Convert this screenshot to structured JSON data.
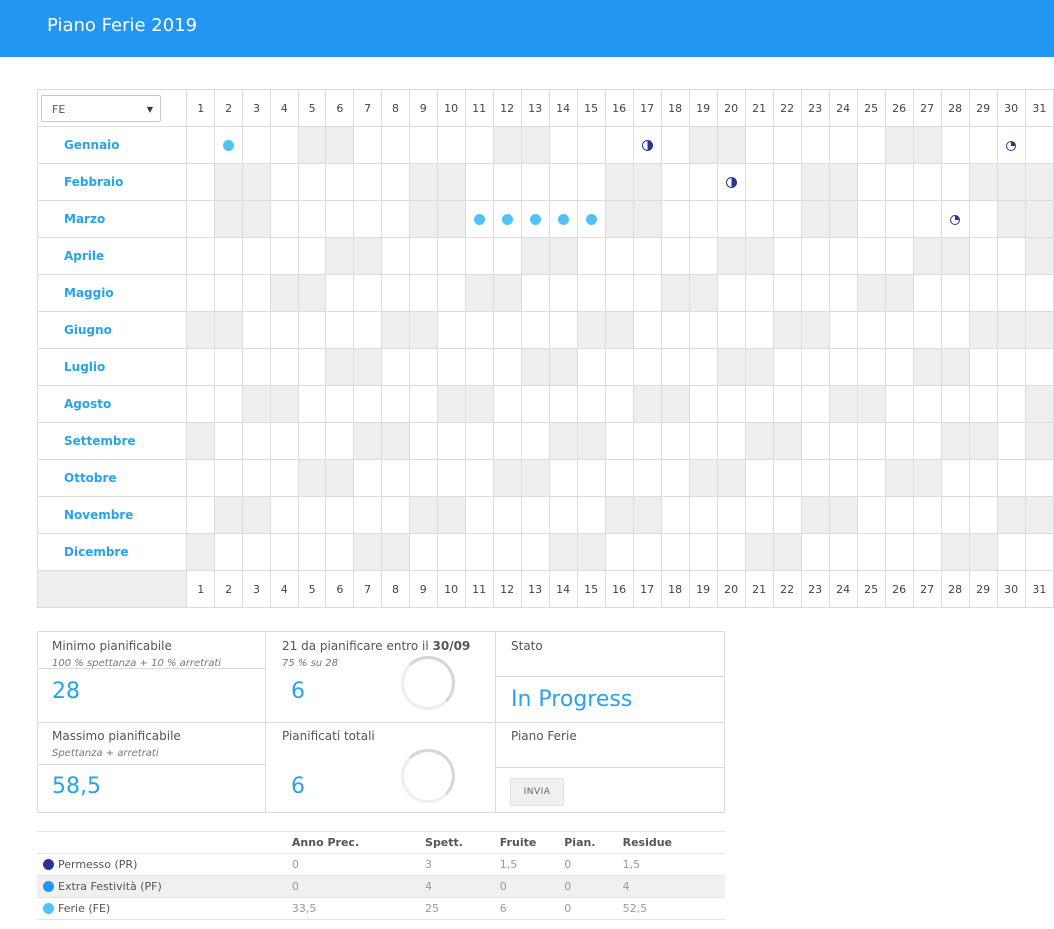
{
  "header": {
    "title": "Piano Ferie 2019"
  },
  "calendar": {
    "filter_value": "FE",
    "days": [
      "1",
      "2",
      "3",
      "4",
      "5",
      "6",
      "7",
      "8",
      "9",
      "10",
      "11",
      "12",
      "13",
      "14",
      "15",
      "16",
      "17",
      "18",
      "19",
      "20",
      "21",
      "22",
      "23",
      "24",
      "25",
      "26",
      "27",
      "28",
      "29",
      "30",
      "31"
    ],
    "months": [
      {
        "name": "Gennaio",
        "days_in_month": 31,
        "weekends": [
          5,
          6,
          12,
          13,
          19,
          20,
          26,
          27
        ],
        "marks": [
          {
            "day": 2,
            "type": "fe"
          },
          {
            "day": 17,
            "type": "pr-half"
          },
          {
            "day": 30,
            "type": "pr-quarter"
          }
        ]
      },
      {
        "name": "Febbraio",
        "days_in_month": 28,
        "weekends": [
          2,
          3,
          9,
          10,
          16,
          17,
          23,
          24
        ],
        "marks": [
          {
            "day": 20,
            "type": "pr-half"
          }
        ]
      },
      {
        "name": "Marzo",
        "days_in_month": 31,
        "weekends": [
          2,
          3,
          9,
          10,
          16,
          17,
          23,
          24,
          30,
          31
        ],
        "marks": [
          {
            "day": 11,
            "type": "fe"
          },
          {
            "day": 12,
            "type": "fe"
          },
          {
            "day": 13,
            "type": "fe"
          },
          {
            "day": 14,
            "type": "fe"
          },
          {
            "day": 15,
            "type": "fe"
          },
          {
            "day": 28,
            "type": "pr-quarter"
          }
        ]
      },
      {
        "name": "Aprile",
        "days_in_month": 30,
        "weekends": [
          6,
          7,
          13,
          14,
          20,
          21,
          27,
          28
        ],
        "marks": []
      },
      {
        "name": "Maggio",
        "days_in_month": 31,
        "weekends": [
          4,
          5,
          11,
          12,
          18,
          19,
          25,
          26
        ],
        "marks": []
      },
      {
        "name": "Giugno",
        "days_in_month": 30,
        "weekends": [
          1,
          2,
          8,
          9,
          15,
          16,
          22,
          23,
          29,
          30
        ],
        "marks": []
      },
      {
        "name": "Luglio",
        "days_in_month": 31,
        "weekends": [
          6,
          7,
          13,
          14,
          20,
          21,
          27,
          28
        ],
        "marks": []
      },
      {
        "name": "Agosto",
        "days_in_month": 31,
        "weekends": [
          3,
          4,
          10,
          11,
          17,
          18,
          24,
          25,
          31
        ],
        "marks": []
      },
      {
        "name": "Settembre",
        "days_in_month": 30,
        "weekends": [
          1,
          7,
          8,
          14,
          15,
          21,
          22,
          28,
          29
        ],
        "marks": []
      },
      {
        "name": "Ottobre",
        "days_in_month": 31,
        "weekends": [
          5,
          6,
          12,
          13,
          19,
          20,
          26,
          27
        ],
        "marks": []
      },
      {
        "name": "Novembre",
        "days_in_month": 30,
        "weekends": [
          2,
          3,
          9,
          10,
          16,
          17,
          23,
          24,
          30
        ],
        "marks": []
      },
      {
        "name": "Dicembre",
        "days_in_month": 31,
        "weekends": [
          1,
          7,
          8,
          14,
          15,
          21,
          22,
          28,
          29
        ],
        "marks": []
      }
    ]
  },
  "summary": {
    "min": {
      "label": "Minimo pianificabile",
      "note": "100 % spettanza + 10 % arretrati",
      "value": "28"
    },
    "to_plan": {
      "label_prefix": "21 da pianificare entro il ",
      "label_date": "30/09",
      "note": "75 % su 28",
      "value": "6"
    },
    "status": {
      "label": "Stato",
      "value": "In Progress"
    },
    "max": {
      "label": "Massimo pianificabile",
      "note": "Spettanza + arretrati",
      "value": "58,5"
    },
    "total": {
      "label": "Pianificati totali",
      "value": "6"
    },
    "plan": {
      "label": "Piano Ferie",
      "button": "INVIA"
    }
  },
  "legend": {
    "headers": [
      "Anno Prec.",
      "Spett.",
      "Fruite",
      "Pian.",
      "Residue"
    ],
    "rows": [
      {
        "name": "Permesso (PR)",
        "color": "#283593",
        "values": [
          "0",
          "3",
          "1,5",
          "0",
          "1,5"
        ]
      },
      {
        "name": "Extra Festività (PF)",
        "color": "#2196f3",
        "values": [
          "0",
          "4",
          "0",
          "0",
          "4"
        ]
      },
      {
        "name": "Ferie (FE)",
        "color": "#4fc3f7",
        "values": [
          "33,5",
          "25",
          "6",
          "0",
          "52,5"
        ]
      }
    ]
  },
  "colors": {
    "header": "#2196f3",
    "accent": "#29a3e8",
    "pr": "#283593",
    "pf": "#2196f3",
    "fe": "#4fc3f7"
  }
}
